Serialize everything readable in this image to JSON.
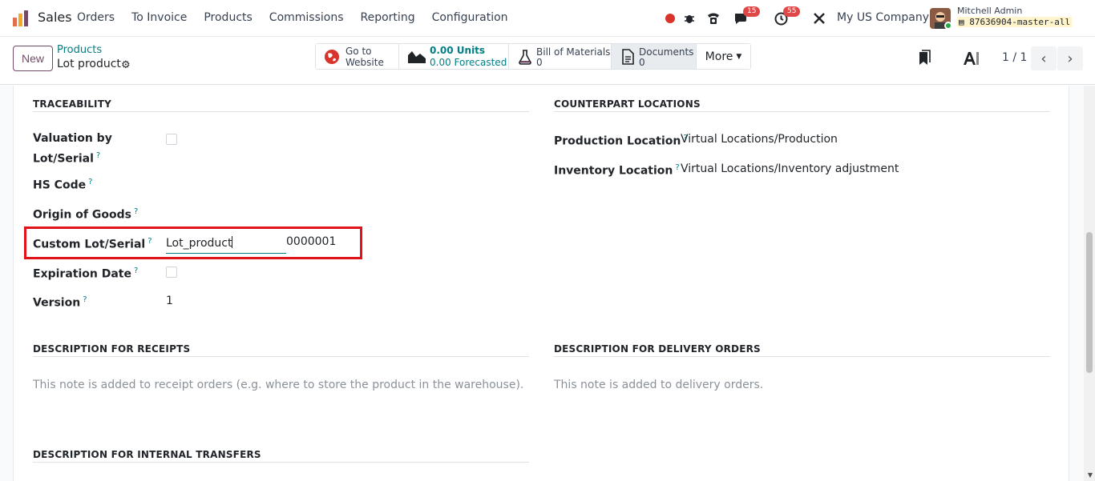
{
  "navbar": {
    "app_name": "Sales",
    "menu": [
      "Orders",
      "To Invoice",
      "Products",
      "Commissions",
      "Reporting",
      "Configuration"
    ],
    "messages_badge": "15",
    "activities_badge": "55",
    "company": "My US Company",
    "user_name": "Mitchell Admin",
    "database": "87636904-master-all"
  },
  "control_panel": {
    "new_label": "New",
    "breadcrumb": "Products",
    "record_name": "Lot product",
    "stats": {
      "website_l1": "Go to",
      "website_l2": "Website",
      "units_l1": "0.00 Units",
      "units_l2": "0.00 Forecasted",
      "bom_l1": "Bill of Materials",
      "bom_l2": "0",
      "documents_l1": "Documents",
      "documents_l2": "0",
      "more_label": "More"
    },
    "pager": "1 / 1"
  },
  "traceability": {
    "title": "TRACEABILITY",
    "valuation_label_1": "Valuation by",
    "valuation_label_2": "Lot/Serial",
    "hs_code_label": "HS Code",
    "origin_label": "Origin of Goods",
    "custom_lot_label": "Custom Lot/Serial",
    "custom_lot_prefix": "Lot_product",
    "custom_lot_number": "0000001",
    "expiration_label": "Expiration Date",
    "version_label": "Version",
    "version_value": "1"
  },
  "counterpart": {
    "title": "COUNTERPART LOCATIONS",
    "production_label": "Production Location",
    "production_value": "Virtual Locations/Production",
    "inventory_label": "Inventory Location",
    "inventory_value": "Virtual Locations/Inventory adjustment"
  },
  "descriptions": {
    "receipts_title": "DESCRIPTION FOR RECEIPTS",
    "receipts_placeholder": "This note is added to receipt orders (e.g. where to store the product in the warehouse).",
    "delivery_title": "DESCRIPTION FOR DELIVERY ORDERS",
    "delivery_placeholder": "This note is added to delivery orders.",
    "internal_title": "DESCRIPTION FOR INTERNAL TRANSFERS"
  },
  "help_mark": "?",
  "colors": {
    "brand": "#714b67",
    "link": "#017e84",
    "highlight": "#e0131a"
  }
}
